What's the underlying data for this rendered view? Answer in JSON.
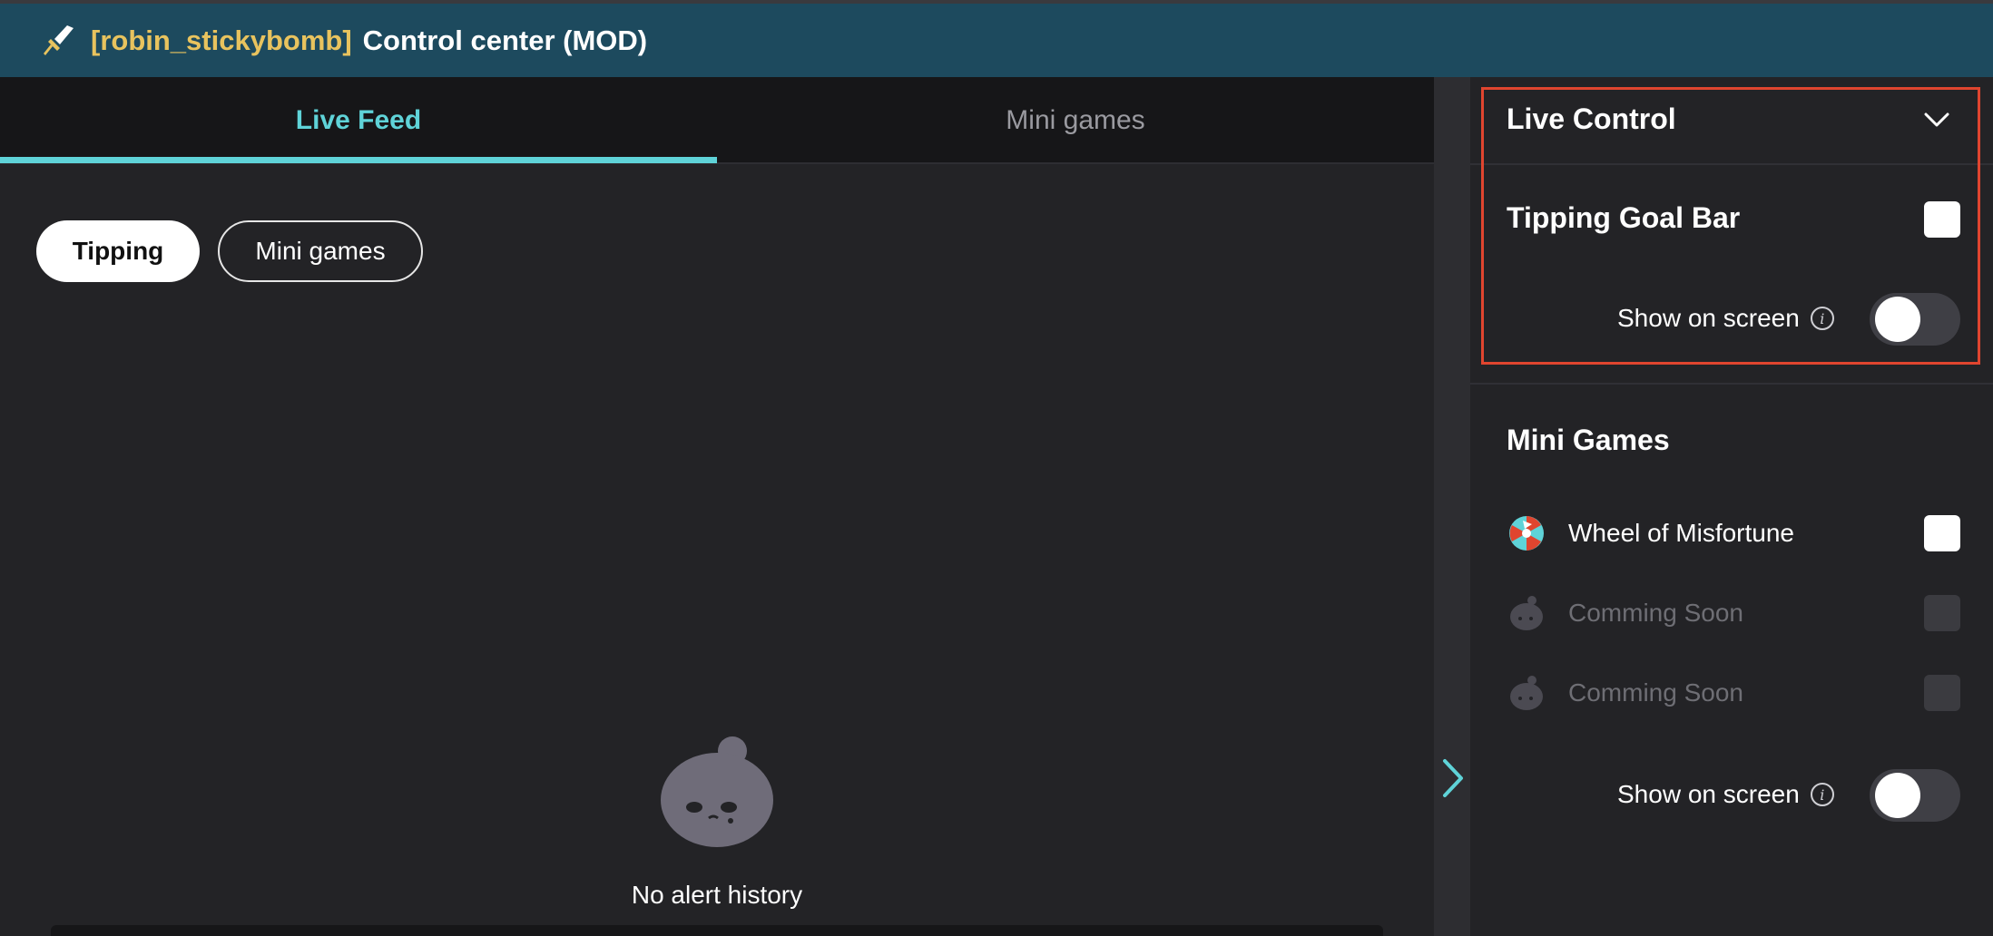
{
  "header": {
    "username": "[robin_stickybomb]",
    "title": "Control center (MOD)"
  },
  "tabs": [
    {
      "label": "Live Feed",
      "active": true
    },
    {
      "label": "Mini games",
      "active": false
    }
  ],
  "filters": [
    {
      "label": "Tipping",
      "active": true
    },
    {
      "label": "Mini games",
      "active": false
    }
  ],
  "empty_state": {
    "text": "No alert history"
  },
  "live_control": {
    "title": "Live Control",
    "tipping_goal_bar": {
      "label": "Tipping Goal Bar",
      "checked": false
    },
    "show_on_screen": {
      "label": "Show on screen",
      "on": false
    }
  },
  "mini_games": {
    "title": "Mini Games",
    "items": [
      {
        "label": "Wheel of Misfortune",
        "enabled": true
      },
      {
        "label": "Comming Soon",
        "enabled": false
      },
      {
        "label": "Comming Soon",
        "enabled": false
      }
    ],
    "show_on_screen": {
      "label": "Show on screen",
      "on": false
    }
  },
  "colors": {
    "header_bg": "#1d4a5e",
    "accent": "#5fd3d8",
    "username": "#e8c35e",
    "highlight_box": "#e0452f"
  },
  "icons": {
    "logo": "sword-icon",
    "expand": "chevron-right-icon",
    "collapse": "chevron-down-icon",
    "info": "info-icon",
    "wheel": "wheel-icon",
    "placeholder": "mascot-icon"
  }
}
